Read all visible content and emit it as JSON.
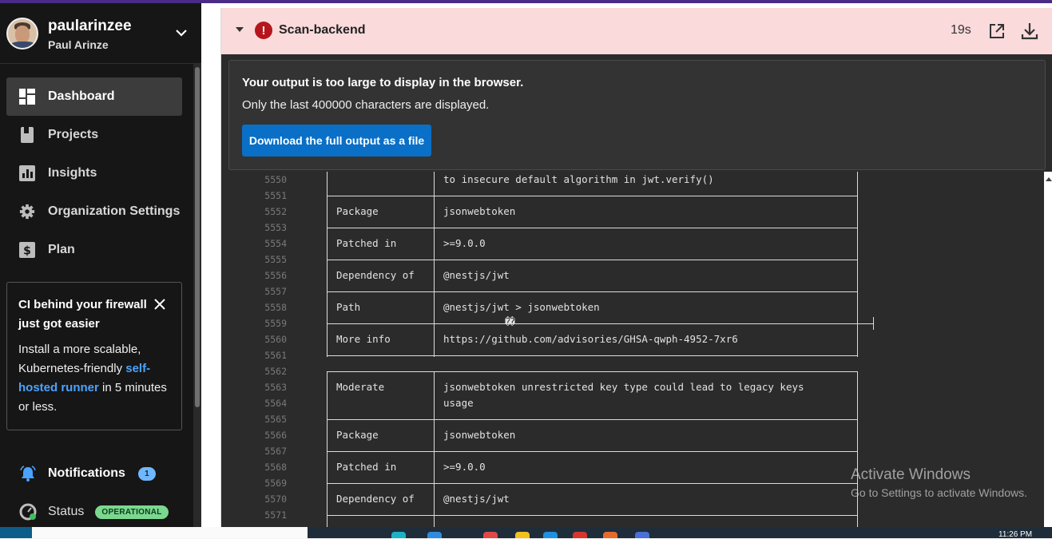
{
  "user": {
    "username": "paularinzee",
    "full_name": "Paul Arinze"
  },
  "nav": {
    "items": [
      {
        "label": "Dashboard",
        "icon": "dashboard-icon",
        "active": true
      },
      {
        "label": "Projects",
        "icon": "projects-icon",
        "active": false
      },
      {
        "label": "Insights",
        "icon": "insights-icon",
        "active": false
      },
      {
        "label": "Organization Settings",
        "icon": "gear-icon",
        "active": false
      },
      {
        "label": "Plan",
        "icon": "dollar-icon",
        "active": false
      }
    ]
  },
  "promo": {
    "title": "CI behind your firewall just got easier",
    "body_prefix": "Install a more scalable, Kubernetes-friendly ",
    "link_text": "self-hosted runner",
    "body_suffix": " in 5 minutes or less."
  },
  "notifications": {
    "label": "Notifications",
    "count": "1"
  },
  "status": {
    "label": "Status",
    "badge": "OPERATIONAL"
  },
  "job": {
    "name": "Scan-backend",
    "duration": "19s",
    "status_icon": "error-icon",
    "warning_title": "Your output is too large to display in the browser.",
    "warning_sub": "Only the last 400000 characters are displayed.",
    "download_button": "Download the full output as a file"
  },
  "log_lines": [
    {
      "n": "5550",
      "c1": "",
      "c2": "to insecure default algorithm in jwt.verify()"
    },
    {
      "n": "5551",
      "c1": "",
      "c2": ""
    },
    {
      "n": "5552",
      "c1": "Package",
      "c2": "jsonwebtoken"
    },
    {
      "n": "5553",
      "c1": "",
      "c2": ""
    },
    {
      "n": "5554",
      "c1": "Patched in",
      "c2": ">=9.0.0"
    },
    {
      "n": "5555",
      "c1": "",
      "c2": ""
    },
    {
      "n": "5556",
      "c1": "Dependency of",
      "c2": "@nestjs/jwt"
    },
    {
      "n": "5557",
      "c1": "",
      "c2": ""
    },
    {
      "n": "5558",
      "c1": "Path",
      "c2": "@nestjs/jwt > jsonwebtoken"
    },
    {
      "n": "5559",
      "c1": "",
      "c2": "",
      "c3": "��"
    },
    {
      "n": "5560",
      "c1": "More info",
      "c2": "https://github.com/advisories/GHSA-qwph-4952-7xr6"
    },
    {
      "n": "5561",
      "c1": "",
      "c2": ""
    },
    {
      "n": "5562",
      "c1": "",
      "c2": ""
    },
    {
      "n": "5563",
      "c1": "Moderate",
      "c2": "jsonwebtoken unrestricted key type could lead to legacy keys"
    },
    {
      "n": "5564",
      "c1": "",
      "c2": "usage"
    },
    {
      "n": "5565",
      "c1": "",
      "c2": ""
    },
    {
      "n": "5566",
      "c1": "Package",
      "c2": "jsonwebtoken"
    },
    {
      "n": "5567",
      "c1": "",
      "c2": ""
    },
    {
      "n": "5568",
      "c1": "Patched in",
      "c2": ">=9.0.0"
    },
    {
      "n": "5569",
      "c1": "",
      "c2": ""
    },
    {
      "n": "5570",
      "c1": "Dependency of",
      "c2": "@nestjs/jwt"
    },
    {
      "n": "5571",
      "c1": "",
      "c2": ""
    }
  ],
  "watermark": {
    "line1": "Activate Windows",
    "line2": "Go to Settings to activate Windows."
  },
  "taskbar": {
    "clock": "11:26 PM"
  },
  "colors": {
    "accent": "#0a6fc7",
    "error": "#b5161d",
    "header_bg": "#fadadb",
    "status_green": "#7bd88f"
  }
}
